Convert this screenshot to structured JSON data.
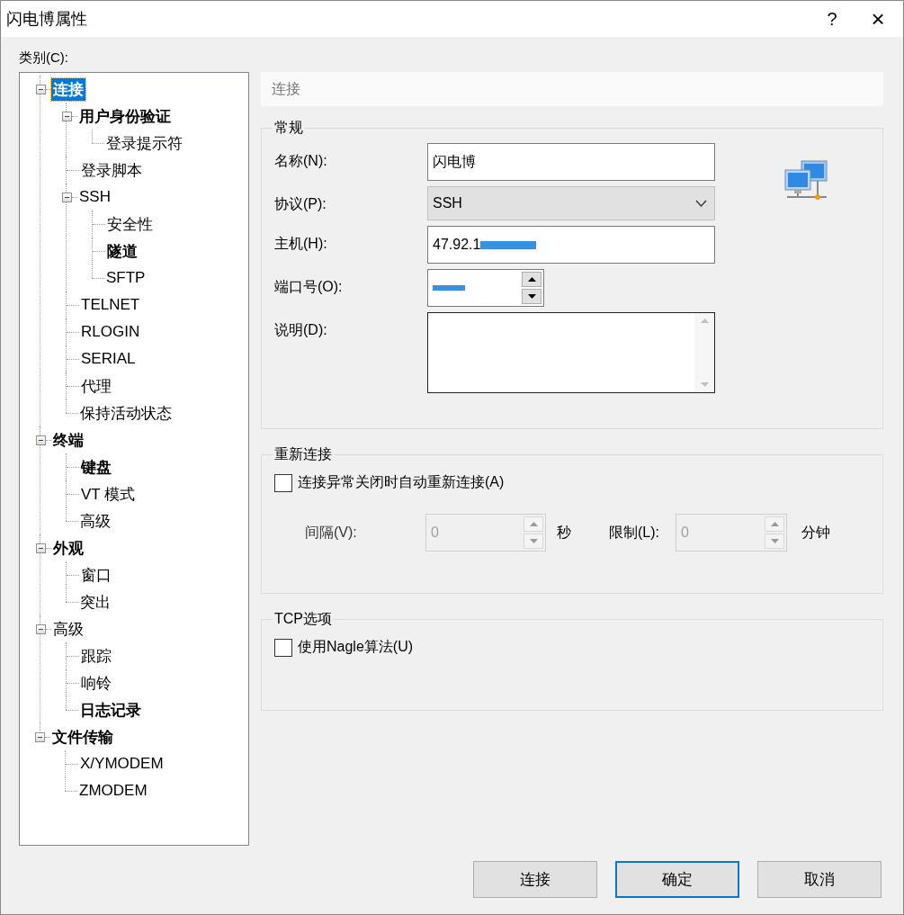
{
  "window": {
    "title": "闪电博属性",
    "help_glyph": "?",
    "close_glyph": "×"
  },
  "category_label": "类别(C):",
  "tree": [
    {
      "label": "连接",
      "bold": true,
      "selected": true,
      "expanded": true,
      "children": [
        {
          "label": "用户身份验证",
          "bold": true,
          "selected": false,
          "expanded": true,
          "children": [
            {
              "label": "登录提示符",
              "bold": false,
              "selected": false
            }
          ]
        },
        {
          "label": "登录脚本",
          "bold": false,
          "selected": false
        },
        {
          "label": "SSH",
          "bold": false,
          "selected": false,
          "expanded": true,
          "children": [
            {
              "label": "安全性",
              "bold": false,
              "selected": false
            },
            {
              "label": "隧道",
              "bold": true,
              "selected": false
            },
            {
              "label": "SFTP",
              "bold": false,
              "selected": false
            }
          ]
        },
        {
          "label": "TELNET",
          "bold": false,
          "selected": false
        },
        {
          "label": "RLOGIN",
          "bold": false,
          "selected": false
        },
        {
          "label": "SERIAL",
          "bold": false,
          "selected": false
        },
        {
          "label": "代理",
          "bold": false,
          "selected": false
        },
        {
          "label": "保持活动状态",
          "bold": false,
          "selected": false
        }
      ]
    },
    {
      "label": "终端",
      "bold": true,
      "selected": false,
      "expanded": true,
      "children": [
        {
          "label": "键盘",
          "bold": true,
          "selected": false
        },
        {
          "label": "VT 模式",
          "bold": false,
          "selected": false
        },
        {
          "label": "高级",
          "bold": false,
          "selected": false
        }
      ]
    },
    {
      "label": "外观",
      "bold": true,
      "selected": false,
      "expanded": true,
      "children": [
        {
          "label": "窗口",
          "bold": false,
          "selected": false
        },
        {
          "label": "突出",
          "bold": false,
          "selected": false
        }
      ]
    },
    {
      "label": "高级",
      "bold": false,
      "selected": false,
      "expanded": true,
      "children": [
        {
          "label": "跟踪",
          "bold": false,
          "selected": false
        },
        {
          "label": "响铃",
          "bold": false,
          "selected": false
        },
        {
          "label": "日志记录",
          "bold": true,
          "selected": false
        }
      ]
    },
    {
      "label": "文件传输",
      "bold": true,
      "selected": false,
      "expanded": true,
      "children": [
        {
          "label": "X/YMODEM",
          "bold": false,
          "selected": false
        },
        {
          "label": "ZMODEM",
          "bold": false,
          "selected": false
        }
      ]
    }
  ],
  "page_header": "连接",
  "general": {
    "title": "常规",
    "fields": [
      {
        "kind": "text",
        "label": "名称(N):",
        "value": "闪电博"
      },
      {
        "kind": "select",
        "label": "协议(P):",
        "value": "SSH"
      },
      {
        "kind": "redacted",
        "label": "主机(H):",
        "value": "47.92.1"
      },
      {
        "kind": "spin",
        "label": "端口号(O):"
      },
      {
        "kind": "textarea",
        "label": "说明(D):"
      }
    ]
  },
  "reconnect": {
    "title": "重新连接",
    "checkbox": {
      "label": "连接异常关闭时自动重新连接(A)",
      "checked": false
    },
    "interval": {
      "label": "间隔(V):",
      "value": "0",
      "unit": "秒",
      "disabled": true
    },
    "limit": {
      "label": "限制(L):",
      "value": "0",
      "unit": "分钟",
      "disabled": true
    }
  },
  "tcp": {
    "title": "TCP选项",
    "checkbox": {
      "label": "使用Nagle算法(U)",
      "checked": false
    }
  },
  "buttons": [
    {
      "label": "连接",
      "default": false
    },
    {
      "label": "确定",
      "default": true
    },
    {
      "label": "取消",
      "default": false
    }
  ]
}
